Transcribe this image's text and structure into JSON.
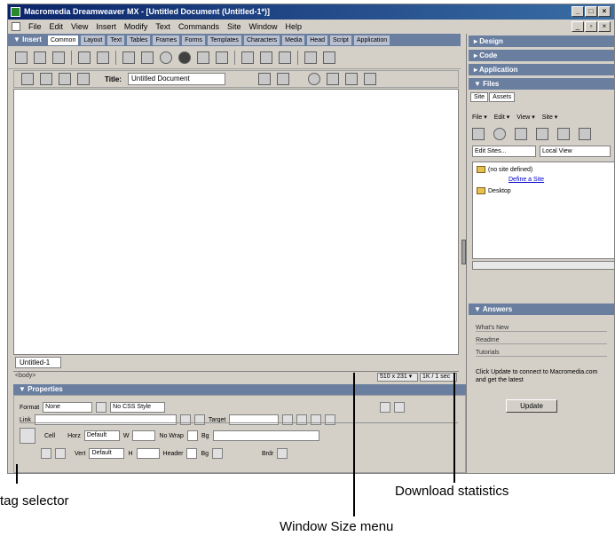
{
  "window": {
    "title": "Macromedia Dreamweaver MX - [Untitled Document (Untitled-1*)]",
    "menu": [
      "File",
      "Edit",
      "View",
      "Insert",
      "Modify",
      "Text",
      "Commands",
      "Site",
      "Window",
      "Help"
    ]
  },
  "insert_bar": {
    "title": "▼ Insert",
    "tabs": [
      "Common",
      "Layout",
      "Text",
      "Tables",
      "Frames",
      "Forms",
      "Templates",
      "Characters",
      "Media",
      "Head",
      "Script",
      "Application"
    ]
  },
  "doc_toolbar": {
    "title_label": "Title:",
    "title_value": "Untitled Document"
  },
  "document": {
    "tab_label": "Untitled-1"
  },
  "statusbar": {
    "tag_selector": "<body>",
    "window_size": "510 x 231 ▾",
    "download_stats": "1K / 1 sec"
  },
  "properties": {
    "header": "▼ Properties",
    "format_label": "Format",
    "format_value": "None",
    "style_value": "No CSS Style",
    "link_label": "Link",
    "target_label": "Target",
    "cell_label": "Cell",
    "horz_label": "Horz",
    "horz_value": "Default",
    "vert_label": "Vert",
    "vert_value": "Default",
    "w_label": "W",
    "h_label": "H",
    "no_wrap_label": "No Wrap",
    "header_label": "Header",
    "bg_label": "Bg",
    "brdr_label": "Brdr"
  },
  "panels": {
    "design": "▸ Design",
    "code": "▸ Code",
    "application": "▸ Application",
    "files": "▼ Files",
    "answers": "▼ Answers"
  },
  "files": {
    "tabs": [
      "Site",
      "Assets"
    ],
    "menu": [
      "File ▾",
      "Edit ▾",
      "View ▾",
      "Site ▾"
    ],
    "site_select": "Edit Sites...",
    "view_select": "Local View",
    "tree_root": "(no site defined)",
    "define_site": "Define a Site",
    "desktop": "Desktop"
  },
  "answers": {
    "items": [
      "What's New",
      "Readme",
      "Tutorials"
    ],
    "text": "Click Update to connect to Macromedia.com and get the latest",
    "update_button": "Update"
  },
  "captions": {
    "tag_selector": "tag selector",
    "download_statistics": "Download statistics",
    "window_size_menu": "Window Size menu"
  }
}
